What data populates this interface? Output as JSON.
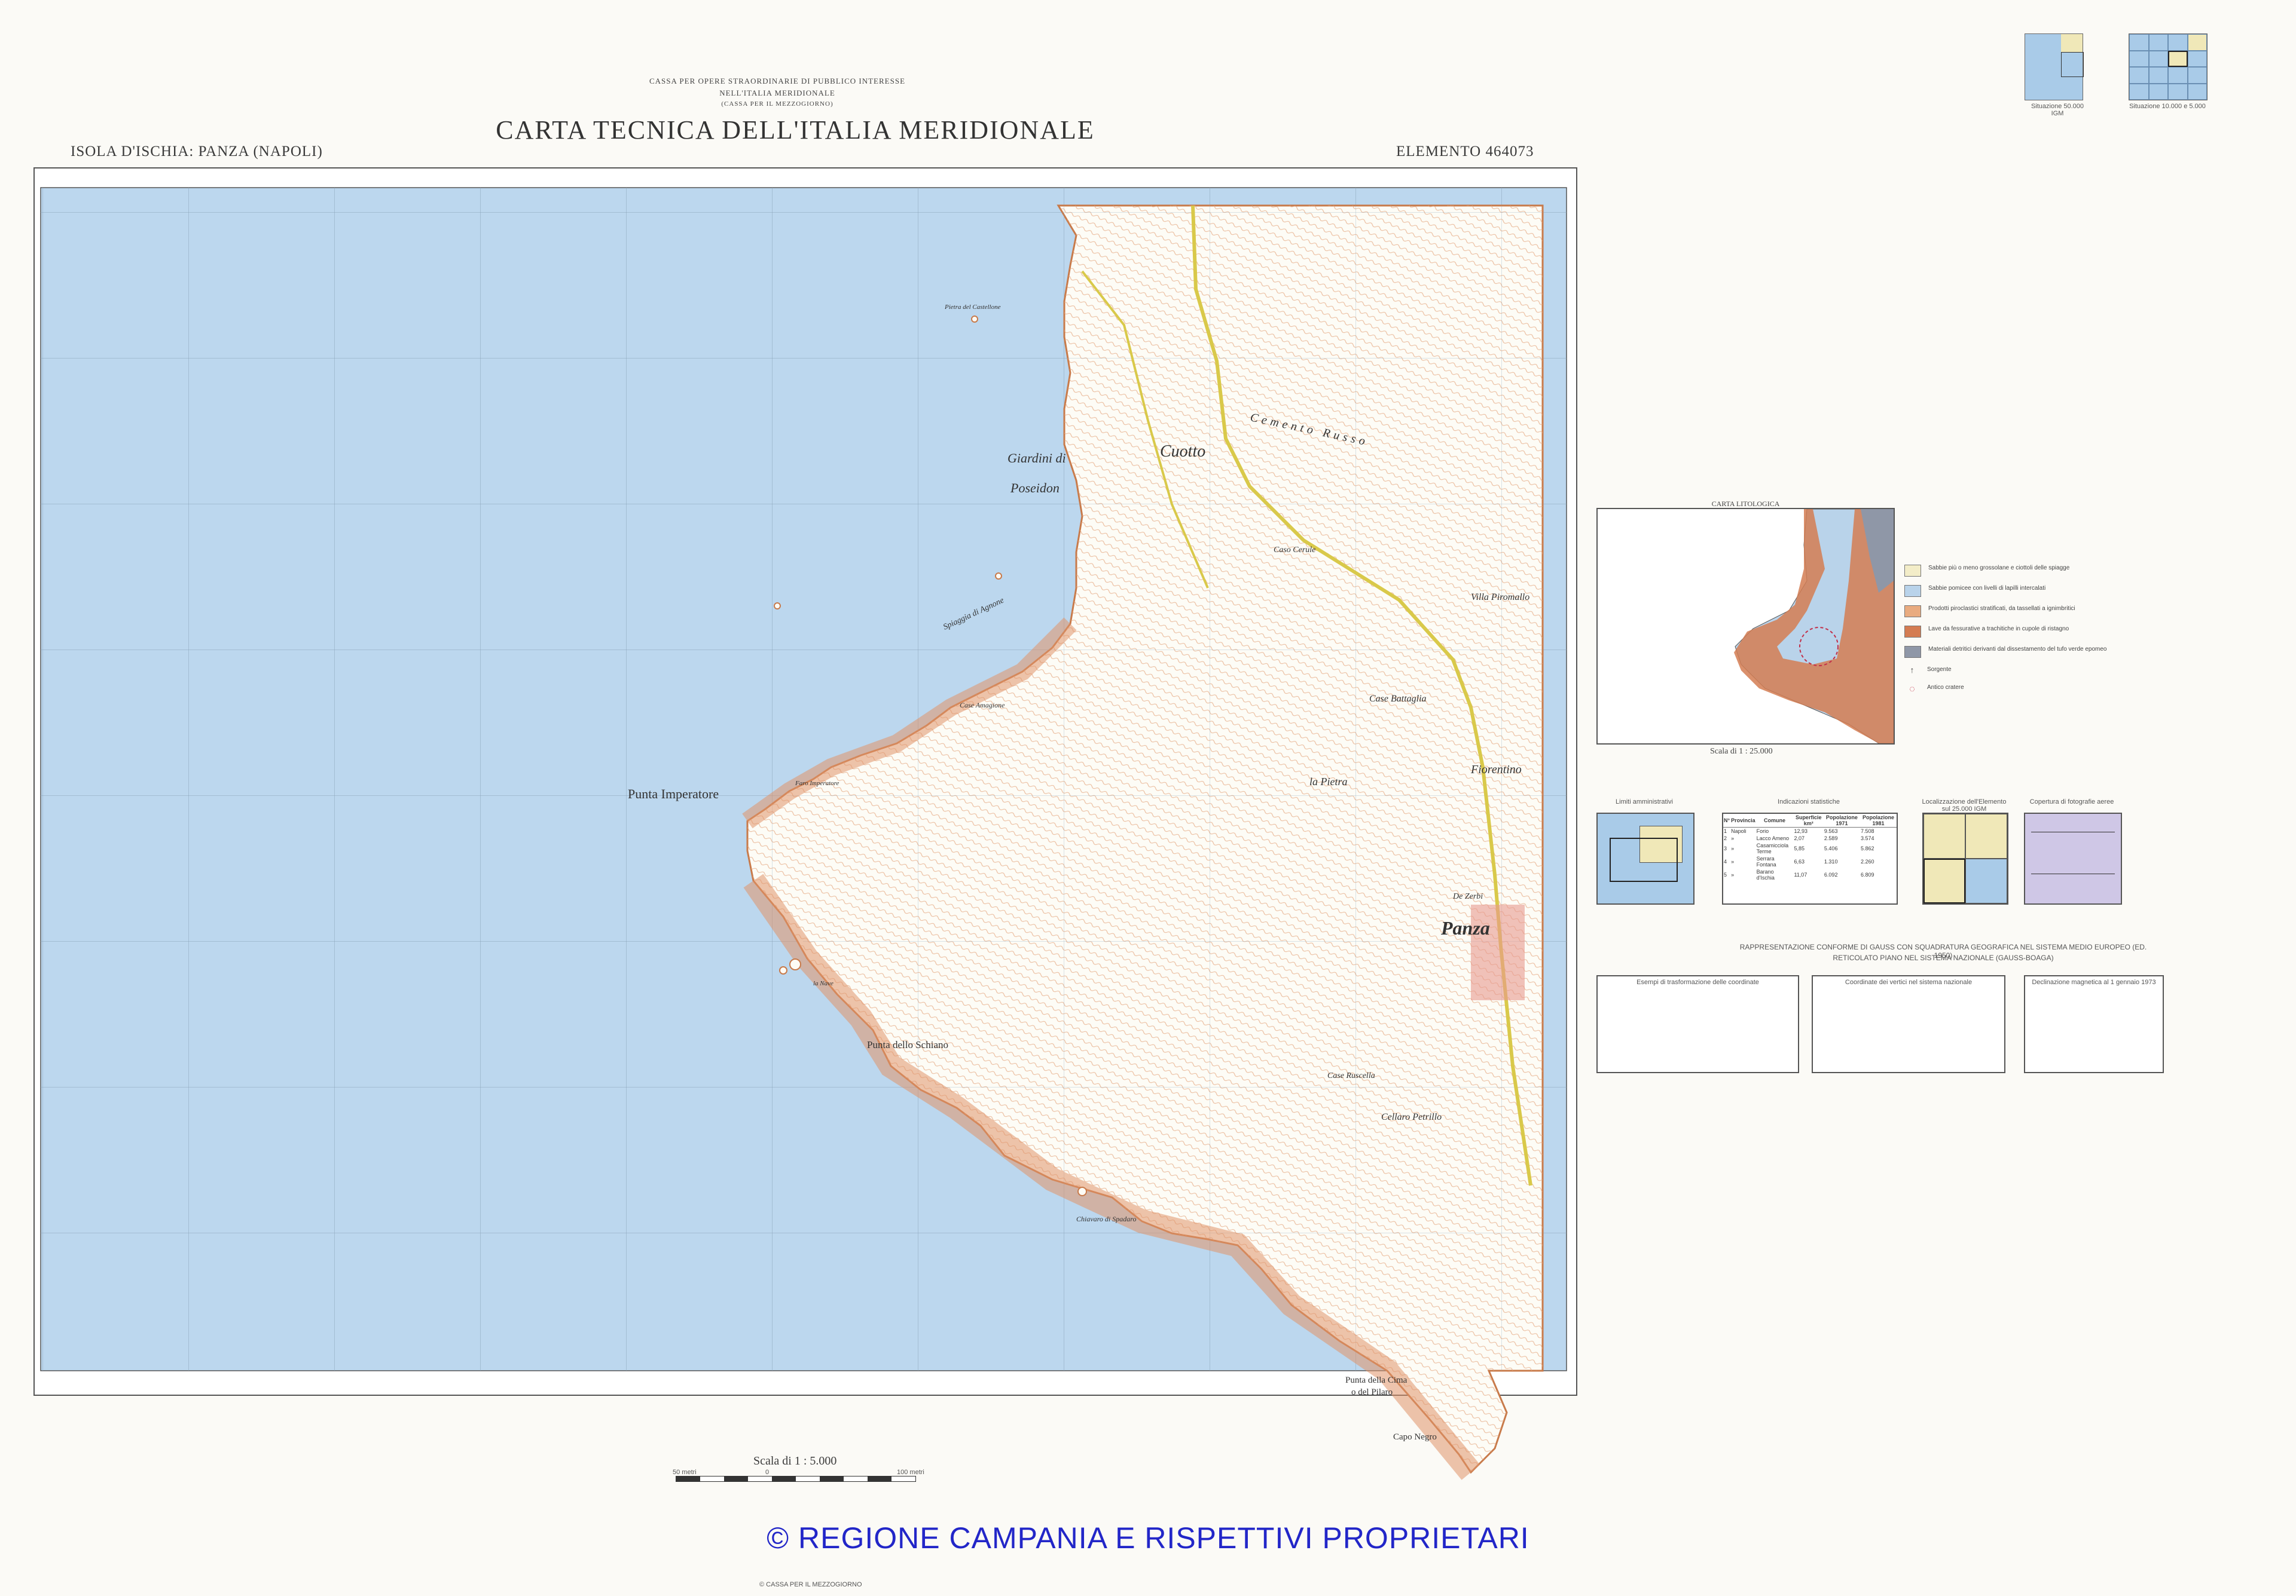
{
  "header": {
    "agency_line1": "CASSA PER OPERE STRAORDINARIE DI PUBBLICO INTERESSE",
    "agency_line2": "NELL'ITALIA MERIDIONALE",
    "agency_line3": "(CASSA PER IL MEZZOGIORNO)",
    "title": "CARTA TECNICA DELL'ITALIA MERIDIONALE",
    "sheet_name": "ISOLA D'ISCHIA: PANZA (NAPOLI)",
    "element": "ELEMENTO  464073"
  },
  "index_maps": {
    "left_caption": "Situazione 50.000 IGM",
    "right_caption": "Situazione 10.000 e 5.000"
  },
  "map": {
    "place_labels": {
      "giardini": "Giardini di",
      "poseidon": "Poseidon",
      "cuotto": "Cuotto",
      "punta_imperatore": "Punta Imperatore",
      "punta_schiano": "Punta dello Schiano",
      "panza": "Panza",
      "fiorentino": "Fiorentino",
      "la_pietra": "la Pietra",
      "case_battaglia": "Case Battaglia",
      "villa_piromallo": "Villa Piromallo",
      "de_zerbi": "De Zerbi",
      "cellaro": "Cellaro Petrillo",
      "chiavaro": "Chiavaro di Spadaro",
      "punta_cima": "Punta della Cima",
      "pilaro": "o del Pilaro",
      "capo_negro": "Capo Negro",
      "la_nave": "la Nave",
      "case_ruscella": "Case Ruscella",
      "caso_cerule": "Caso Cerule",
      "cemento_russo": "Cemento Russo",
      "spiaggia": "Spiaggia di Agnone",
      "faro": "Faro Imperatore",
      "pietra_castellone": "Pietra del Castellone",
      "case_amagione": "Case Amagione"
    }
  },
  "lithology": {
    "title": "CARTA LITOLOGICA",
    "scale": "Scala di 1 : 25.000",
    "legend": [
      {
        "color": "#f3edc8",
        "text": "Sabbie più o meno grossolane e ciottoli delle spiagge"
      },
      {
        "color": "#b9d3ea",
        "text": "Sabbie pomicee con livelli di lapilli intercalati"
      },
      {
        "color": "#e9ab7f",
        "text": "Prodotti piroclastici stratificati, da tassellati a ignimbritici"
      },
      {
        "color": "#d47c52",
        "text": "Lave da fessurative a trachitiche in cupole di ristagno"
      },
      {
        "color": "#8f97a7",
        "text": "Materiali detritici derivanti dal dissestamento del tufo verde epomeo"
      }
    ],
    "symbol_labels": {
      "sorgente": "Sorgente",
      "centro": "Antico cratere"
    }
  },
  "panels": {
    "limiti": "Limiti amministrativi",
    "indicazioni": "Indicazioni statistiche",
    "localizzazione": "Localizzazione dell'Elemento sul 25.000 IGM",
    "copertura": "Copertura di fotografie aeree",
    "stats_headers": [
      "N°",
      "Provincia",
      "Comune",
      "Superficie km²",
      "Popolazione 1971",
      "Popolazione 1981"
    ],
    "stats_rows": [
      [
        "1",
        "Napoli",
        "Forio",
        "12,93",
        "9.563",
        "7.508"
      ],
      [
        "2",
        "»",
        "Lacco Ameno",
        "2,07",
        "2.589",
        "3.574"
      ],
      [
        "3",
        "»",
        "Casamicciola Terme",
        "5,85",
        "5.406",
        "5.862"
      ],
      [
        "4",
        "»",
        "Serrara Fontana",
        "6,63",
        "1.310",
        "2.260"
      ],
      [
        "5",
        "»",
        "Barano d'Ischia",
        "11,07",
        "6.092",
        "6.809"
      ]
    ]
  },
  "projection": {
    "title": "RAPPRESENTAZIONE CONFORME DI GAUSS CON SQUADRATURA GEOGRAFICA NEL SISTEMA MEDIO EUROPEO (ED. 1950)",
    "subtitle": "RETICOLATO PIANO NEL SISTEMA NAZIONALE (GAUSS-BOAGA)",
    "box1": "Esempi di trasformazione delle coordinate",
    "box2": "Coordinate dei vertici nel sistema nazionale",
    "box3": "Declinazione magnetica al 1 gennaio 1973"
  },
  "footer": {
    "scale": "Scala di 1 : 5.000",
    "scale_ticks": [
      "50 metri",
      "0",
      "100 metri"
    ],
    "copyright": "© REGIONE CAMPANIA E RISPETTIVI PROPRIETARI",
    "bottom_credit": "CASSA PER IL MEZZOGIORNO"
  },
  "colors": {
    "sea": "#bcd7ee",
    "land": "#fdfcf6",
    "contour": "#d98a5a",
    "road": "#d9c94a",
    "copyright": "#2226c8"
  }
}
